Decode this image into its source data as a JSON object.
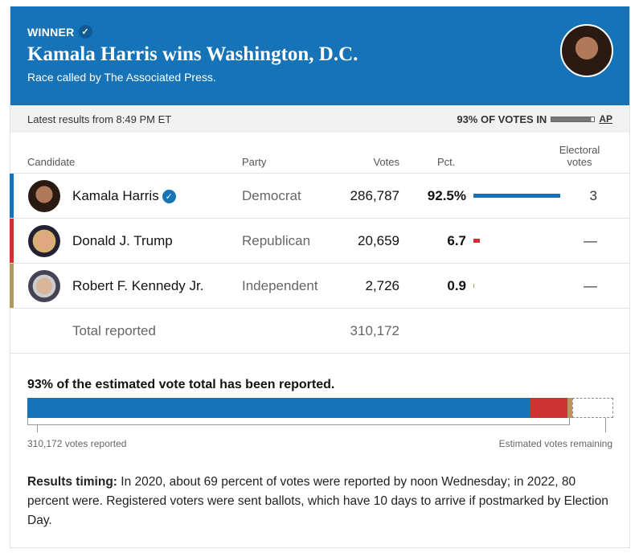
{
  "header": {
    "winner_label": "WINNER",
    "title": "Kamala Harris wins Washington, D.C.",
    "subtitle": "Race called by The Associated Press."
  },
  "status": {
    "latest": "Latest results from 8:49 PM ET",
    "votes_in": "93% OF VOTES IN",
    "votes_in_pct": 93,
    "source": "AP"
  },
  "table": {
    "columns": [
      "Candidate",
      "Party",
      "Votes",
      "Pct.",
      "Electoral votes"
    ],
    "rows": [
      {
        "name": "Kamala Harris",
        "party": "Democrat",
        "votes": "286,787",
        "pct": "92.5%",
        "pct_value": 92.5,
        "ev": "3",
        "color": "#1673b8",
        "winner": true
      },
      {
        "name": "Donald J. Trump",
        "party": "Republican",
        "votes": "20,659",
        "pct": "6.7",
        "pct_value": 6.7,
        "ev": "—",
        "color": "#cc3333"
      },
      {
        "name": "Robert F. Kennedy Jr.",
        "party": "Independent",
        "votes": "2,726",
        "pct": "0.9",
        "pct_value": 0.9,
        "ev": "—",
        "color": "#b09a5c"
      }
    ],
    "total_label": "Total reported",
    "total_votes": "310,172"
  },
  "reporting": {
    "headline": "93% of the estimated vote total has been reported.",
    "reported_label": "310,172 votes reported",
    "remaining_label": "Estimated votes remaining"
  },
  "timing": {
    "label": "Results timing:",
    "text": " In 2020, about 69 percent of votes were reported by noon Wednesday; in 2022, 80 percent were. Registered voters were sent ballots, which have 10 days to arrive if postmarked by Election Day."
  }
}
